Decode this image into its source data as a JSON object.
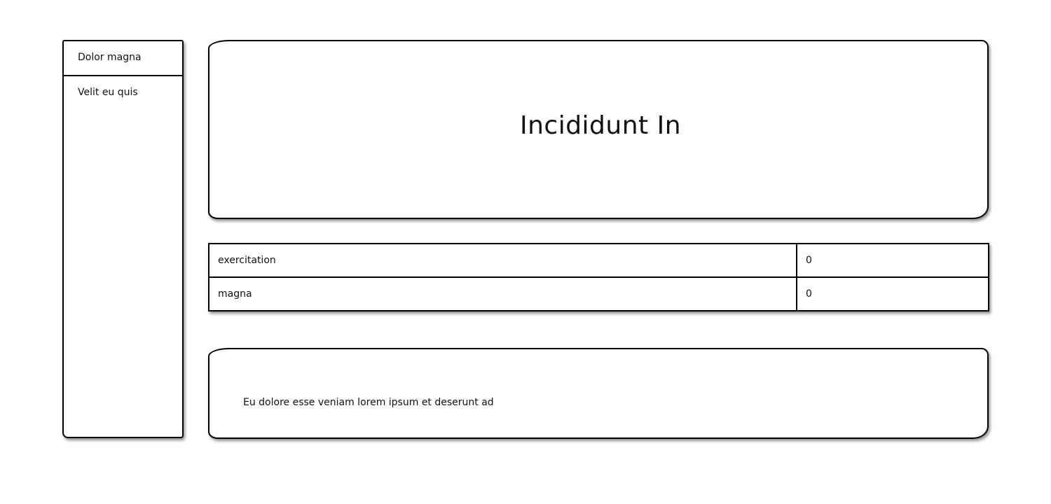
{
  "sidebar": {
    "items": [
      {
        "label": "Dolor magna"
      },
      {
        "label": "Velit eu quis"
      }
    ]
  },
  "hero": {
    "title": "Incididunt In"
  },
  "table": {
    "rows": [
      {
        "key": "exercitation",
        "value": "0"
      },
      {
        "key": "magna",
        "value": "0"
      }
    ]
  },
  "footer": {
    "text": "Eu dolore esse veniam lorem ipsum et deserunt ad"
  }
}
